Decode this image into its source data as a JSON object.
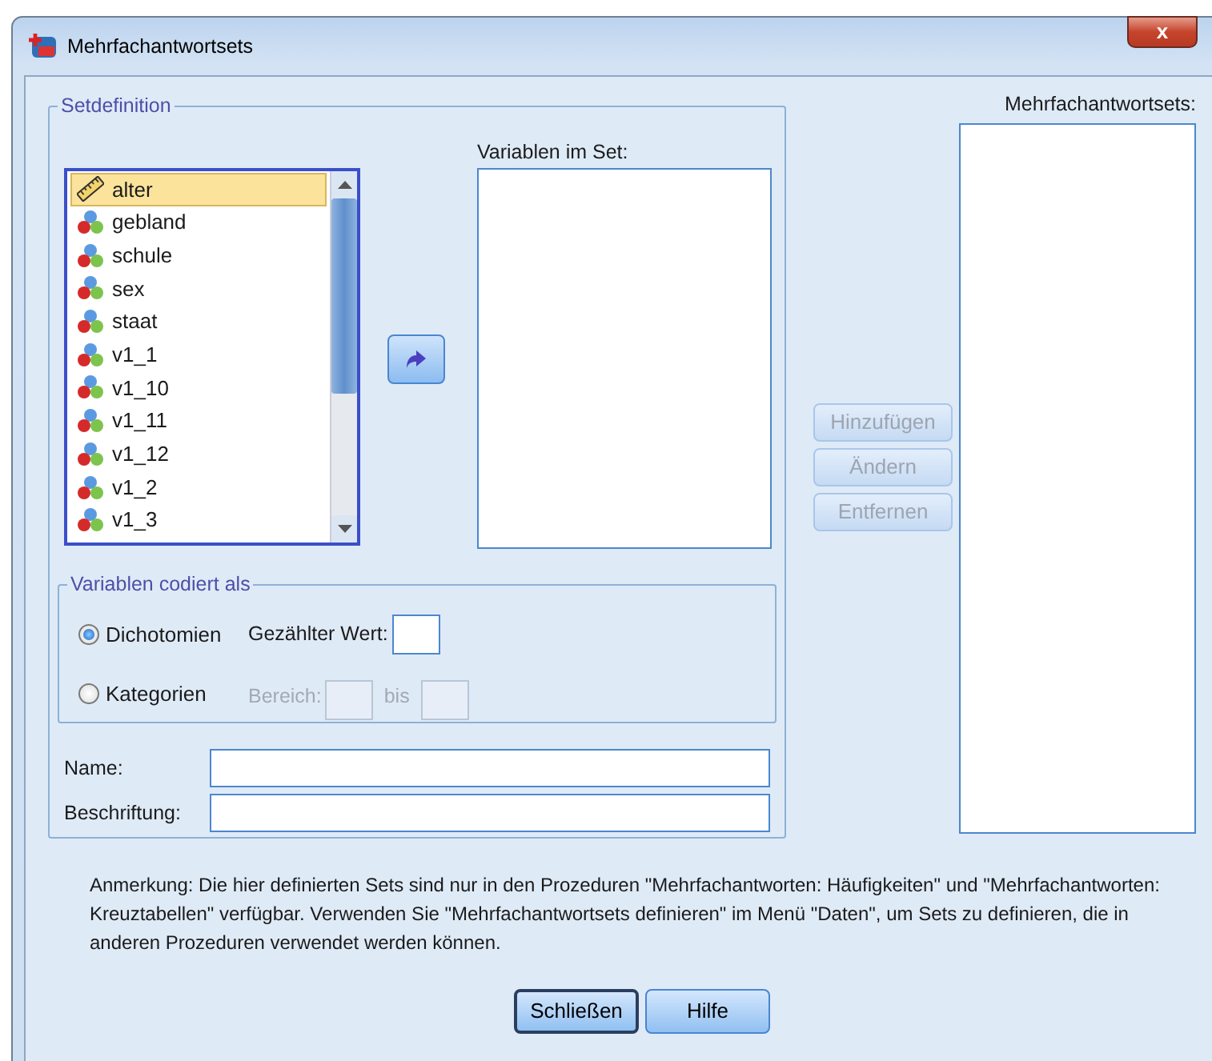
{
  "window": {
    "title": "Mehrfachantwortsets",
    "close": "x"
  },
  "set_definition": {
    "legend": "Setdefinition",
    "variables": [
      {
        "name": "alter",
        "kind": "scale",
        "selected": true
      },
      {
        "name": "gebland",
        "kind": "nominal",
        "selected": false
      },
      {
        "name": "schule",
        "kind": "nominal",
        "selected": false
      },
      {
        "name": "sex",
        "kind": "nominal",
        "selected": false
      },
      {
        "name": "staat",
        "kind": "nominal",
        "selected": false
      },
      {
        "name": "v1_1",
        "kind": "nominal",
        "selected": false
      },
      {
        "name": "v1_10",
        "kind": "nominal",
        "selected": false
      },
      {
        "name": "v1_11",
        "kind": "nominal",
        "selected": false
      },
      {
        "name": "v1_12",
        "kind": "nominal",
        "selected": false
      },
      {
        "name": "v1_2",
        "kind": "nominal",
        "selected": false
      },
      {
        "name": "v1_3",
        "kind": "nominal",
        "selected": false
      }
    ],
    "set_label": "Variablen im Set:",
    "coding": {
      "legend": "Variablen codiert als",
      "options": [
        {
          "label": "Dichotomien",
          "selected": true
        },
        {
          "label": "Kategorien",
          "selected": false
        }
      ],
      "counted_value": {
        "label": "Gezählter Wert:",
        "disabled": false
      },
      "range": {
        "label": "Bereich:",
        "to": "bis",
        "disabled": true
      }
    },
    "name_label": "Name:",
    "caption_label": "Beschriftung:"
  },
  "set_buttons": [
    {
      "label": "Hinzufügen",
      "disabled": true
    },
    {
      "label": "Ändern",
      "disabled": true
    },
    {
      "label": "Entfernen",
      "disabled": true
    }
  ],
  "sets_label": "Mehrfachantwortsets:",
  "note": "Anmerkung: Die hier definierten Sets sind nur in den Prozeduren \"Mehrfachantworten: Häufigkeiten\" und \"Mehrfachantworten: Kreuztabellen\" verfügbar. Verwenden Sie \"Mehrfachantwortsets definieren\" im Menü \"Daten\", um Sets zu definieren, die in anderen Prozeduren verwendet werden können.",
  "buttons": [
    {
      "label": "Schließen",
      "focused": true
    },
    {
      "label": "Hilfe",
      "focused": false
    }
  ]
}
